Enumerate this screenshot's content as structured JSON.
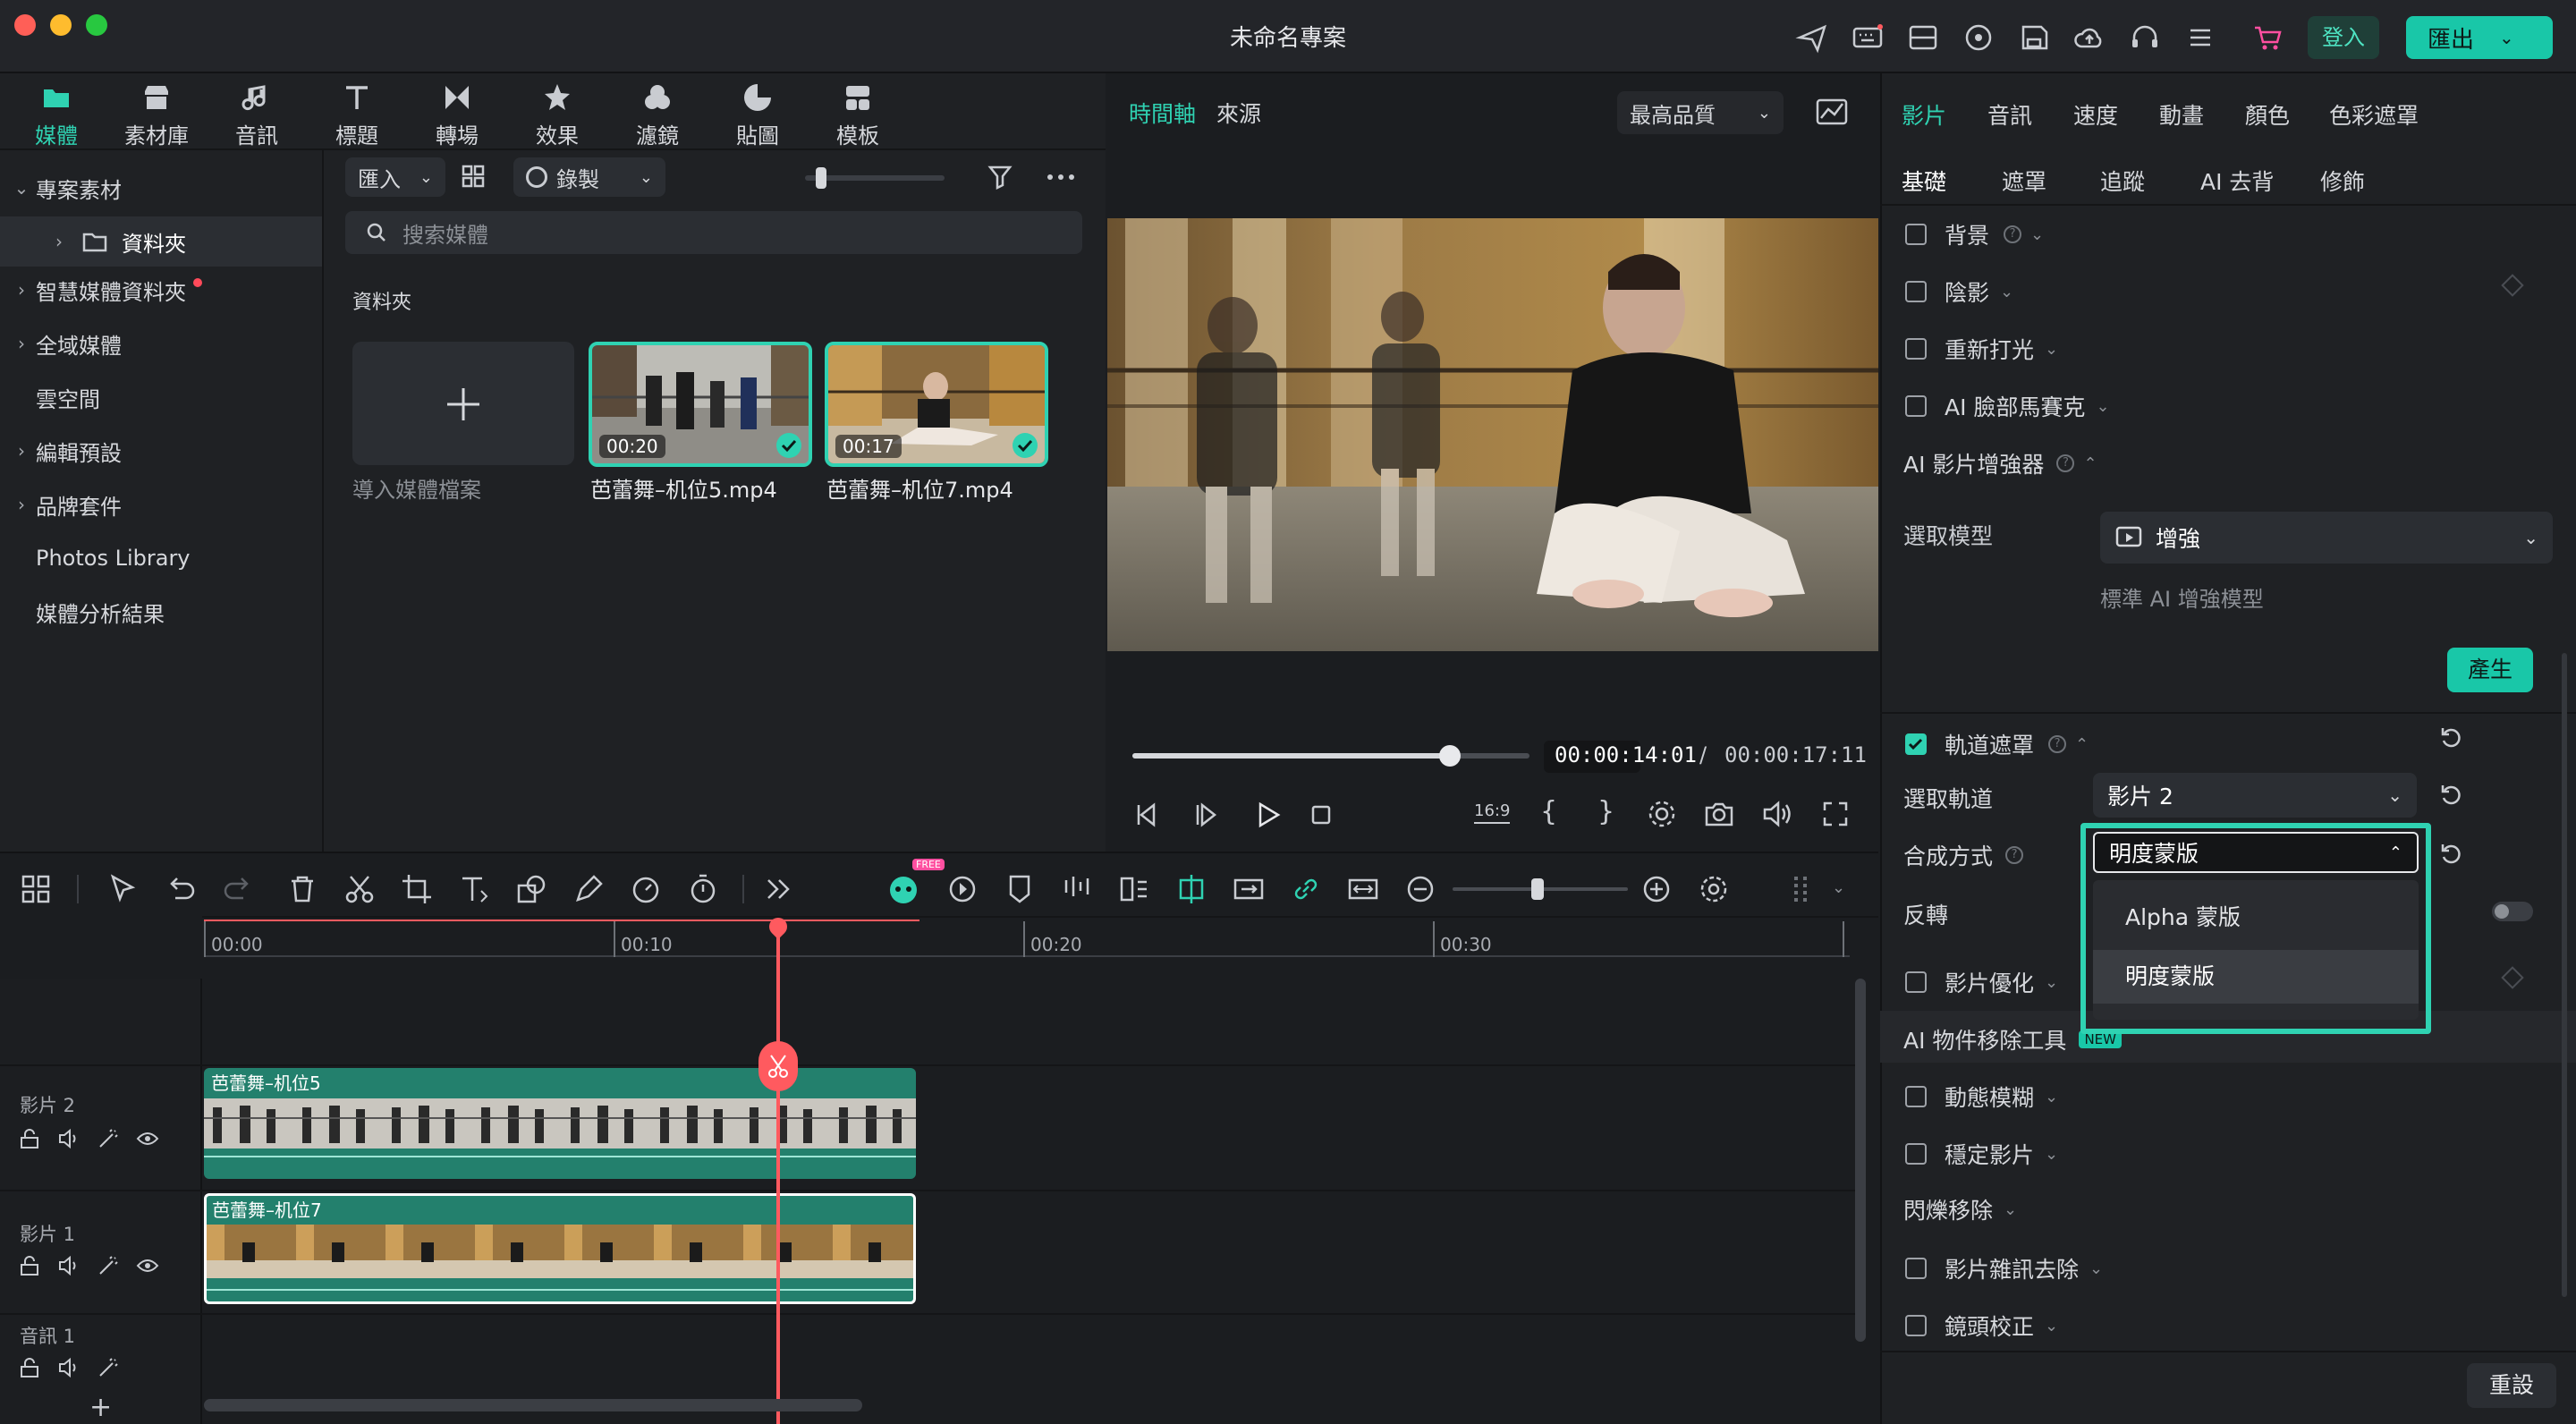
{
  "window": {
    "title": "未命名專案",
    "login_label": "登入",
    "export_label": "匯出"
  },
  "media_tabs": [
    {
      "label": "媒體",
      "icon": "media-icon",
      "active": true
    },
    {
      "label": "素材庫",
      "icon": "store-icon"
    },
    {
      "label": "音訊",
      "icon": "music-icon"
    },
    {
      "label": "標題",
      "icon": "text-icon"
    },
    {
      "label": "轉場",
      "icon": "transition-icon"
    },
    {
      "label": "效果",
      "icon": "effects-icon"
    },
    {
      "label": "濾鏡",
      "icon": "filter-icon"
    },
    {
      "label": "貼圖",
      "icon": "sticker-icon"
    },
    {
      "label": "模板",
      "icon": "template-icon"
    }
  ],
  "sidebar": {
    "items": [
      {
        "label": "專案素材",
        "chevron": "⌄"
      },
      {
        "label": "資料夾",
        "chevron": "›"
      },
      {
        "label": "智慧媒體資料夾",
        "chevron": "›"
      },
      {
        "label": "全域媒體",
        "chevron": "›"
      },
      {
        "label": "雲空間",
        "chevron": ""
      },
      {
        "label": "編輯預設",
        "chevron": "›"
      },
      {
        "label": "品牌套件",
        "chevron": "›"
      },
      {
        "label": "Photos Library",
        "chevron": ""
      },
      {
        "label": "媒體分析結果",
        "chevron": ""
      }
    ]
  },
  "media_toolbar": {
    "import_label": "匯入",
    "record_label": "錄製",
    "search_placeholder": "搜索媒體",
    "section_label": "資料夾",
    "import_tile_label": "導入媒體檔案"
  },
  "clips": [
    {
      "name": "芭蕾舞–机位5.mp4",
      "duration": "00:20"
    },
    {
      "name": "芭蕾舞–机位7.mp4",
      "duration": "00:17"
    }
  ],
  "preview": {
    "tab_timeline": "時間軸",
    "tab_source": "來源",
    "quality": "最高品質",
    "current_time": "00:00:14:01",
    "separator": "/",
    "total_time": "00:00:17:11",
    "progress": 0.8,
    "aspect_label": "16:9"
  },
  "inspector": {
    "tabs": [
      "影片",
      "音訊",
      "速度",
      "動畫",
      "顏色",
      "色彩遮罩"
    ],
    "sub_tabs": [
      "基礎",
      "遮罩",
      "追蹤",
      "AI 去背",
      "修飾"
    ],
    "props": {
      "background": "背景",
      "shadow": "陰影",
      "relight": "重新打光",
      "face_mosaic": "AI 臉部馬賽克",
      "enhancer": "AI 影片增強器",
      "select_model": "選取模型",
      "model_value": "增強",
      "model_desc": "標準 AI 增強模型",
      "generate": "產生",
      "track_matte": "軌道遮罩",
      "select_track": "選取軌道",
      "track_value": "影片 2",
      "blend_mode": "合成方式",
      "blend_value": "明度蒙版",
      "invert": "反轉",
      "video_optimize": "影片優化",
      "object_removal": "AI 物件移除工具",
      "new_badge": "NEW",
      "motion_blur": "動態模糊",
      "stabilize": "穩定影片",
      "deflicker": "閃爍移除",
      "denoise": "影片雜訊去除",
      "lens_correction": "鏡頭校正",
      "reset": "重設"
    },
    "dropdown_options": [
      "Alpha 蒙版",
      "明度蒙版"
    ]
  },
  "timeline": {
    "ruler": [
      "00:00",
      "00:10",
      "00:20",
      "00:30"
    ],
    "free_badge": "FREE",
    "tracks": [
      {
        "label": "影片 2",
        "clip": "芭蕾舞–机位5"
      },
      {
        "label": "影片 1",
        "clip": "芭蕾舞–机位7"
      },
      {
        "label": "音訊 1",
        "clip": ""
      }
    ],
    "add_track": "+"
  },
  "colors": {
    "accent": "#2fd2b2",
    "playhead": "#ff5a5f",
    "clip": "#23806d"
  }
}
